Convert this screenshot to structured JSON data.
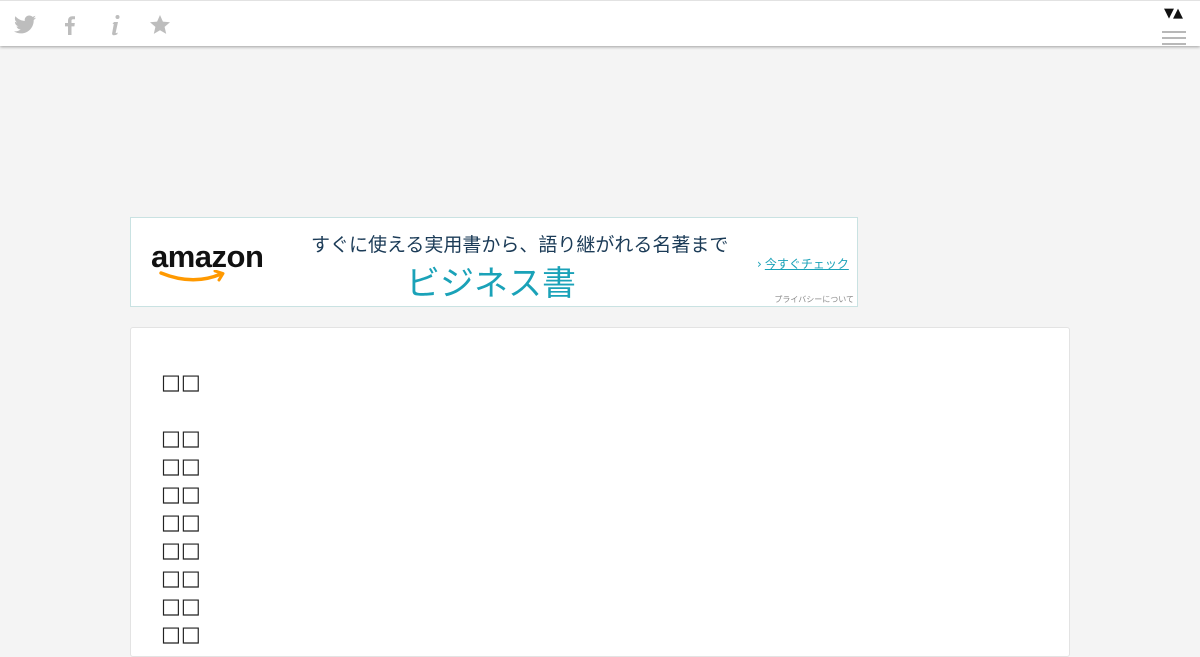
{
  "toolbar": {
    "icons": [
      "twitter-icon",
      "facebook-icon",
      "info-icon",
      "star-icon"
    ],
    "nav_arrows": "▼▲",
    "icon_color": "#bdbdbd"
  },
  "ad": {
    "logo_text": "amazon",
    "tagline": "すぐに使える実用書から、語り継がれる名著まで",
    "headline": "ビジネス書",
    "cta_arrow": "›",
    "cta": "今すぐチェック",
    "privacy": "プライバシーについて",
    "accent_color": "#1aa2b8",
    "smile_color": "#f90"
  },
  "content": {
    "title": "□□",
    "lines": [
      "□□",
      "□□",
      "□□",
      "□□",
      "□□",
      "□□",
      "□□",
      "□□"
    ]
  }
}
